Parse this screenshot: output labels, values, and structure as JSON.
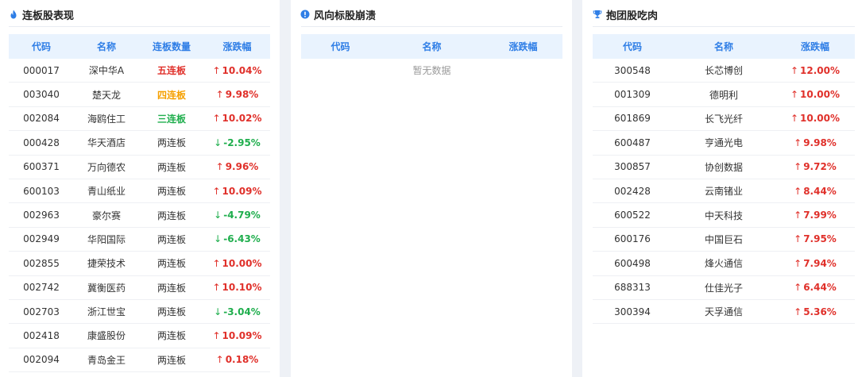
{
  "panels": {
    "streak": {
      "title": "连板股表现",
      "headers": [
        "代码",
        "名称",
        "连板数量",
        "涨跌幅"
      ],
      "rows": [
        {
          "code": "000017",
          "name": "深中华A",
          "board": "五连板",
          "board_level": "red",
          "dir": "up",
          "chg": "10.04%"
        },
        {
          "code": "003040",
          "name": "楚天龙",
          "board": "四连板",
          "board_level": "orange",
          "dir": "up",
          "chg": "9.98%"
        },
        {
          "code": "002084",
          "name": "海鸥住工",
          "board": "三连板",
          "board_level": "green",
          "dir": "up",
          "chg": "10.02%"
        },
        {
          "code": "000428",
          "name": "华天酒店",
          "board": "两连板",
          "board_level": "plain",
          "dir": "down",
          "chg": "-2.95%"
        },
        {
          "code": "600371",
          "name": "万向德农",
          "board": "两连板",
          "board_level": "plain",
          "dir": "up",
          "chg": "9.96%"
        },
        {
          "code": "600103",
          "name": "青山纸业",
          "board": "两连板",
          "board_level": "plain",
          "dir": "up",
          "chg": "10.09%"
        },
        {
          "code": "002963",
          "name": "豪尔赛",
          "board": "两连板",
          "board_level": "plain",
          "dir": "down",
          "chg": "-4.79%"
        },
        {
          "code": "002949",
          "name": "华阳国际",
          "board": "两连板",
          "board_level": "plain",
          "dir": "down",
          "chg": "-6.43%"
        },
        {
          "code": "002855",
          "name": "捷荣技术",
          "board": "两连板",
          "board_level": "plain",
          "dir": "up",
          "chg": "10.00%"
        },
        {
          "code": "002742",
          "name": "冀衡医药",
          "board": "两连板",
          "board_level": "plain",
          "dir": "up",
          "chg": "10.10%"
        },
        {
          "code": "002703",
          "name": "浙江世宝",
          "board": "两连板",
          "board_level": "plain",
          "dir": "down",
          "chg": "-3.04%"
        },
        {
          "code": "002418",
          "name": "康盛股份",
          "board": "两连板",
          "board_level": "plain",
          "dir": "up",
          "chg": "10.09%"
        },
        {
          "code": "002094",
          "name": "青岛金王",
          "board": "两连板",
          "board_level": "plain",
          "dir": "up",
          "chg": "0.18%"
        }
      ]
    },
    "collapse": {
      "title": "风向标股崩溃",
      "headers": [
        "代码",
        "名称",
        "涨跌幅"
      ],
      "empty_text": "暂无数据"
    },
    "cluster": {
      "title": "抱团股吃肉",
      "headers": [
        "代码",
        "名称",
        "涨跌幅"
      ],
      "rows": [
        {
          "code": "300548",
          "name": "长芯博创",
          "dir": "up",
          "chg": "12.00%"
        },
        {
          "code": "001309",
          "name": "德明利",
          "dir": "up",
          "chg": "10.00%"
        },
        {
          "code": "601869",
          "name": "长飞光纤",
          "dir": "up",
          "chg": "10.00%"
        },
        {
          "code": "600487",
          "name": "亨通光电",
          "dir": "up",
          "chg": "9.98%"
        },
        {
          "code": "300857",
          "name": "协创数据",
          "dir": "up",
          "chg": "9.72%"
        },
        {
          "code": "002428",
          "name": "云南锗业",
          "dir": "up",
          "chg": "8.44%"
        },
        {
          "code": "600522",
          "name": "中天科技",
          "dir": "up",
          "chg": "7.99%"
        },
        {
          "code": "600176",
          "name": "中国巨石",
          "dir": "up",
          "chg": "7.95%"
        },
        {
          "code": "600498",
          "name": "烽火通信",
          "dir": "up",
          "chg": "7.94%"
        },
        {
          "code": "688313",
          "name": "仕佳光子",
          "dir": "up",
          "chg": "6.44%"
        },
        {
          "code": "300394",
          "name": "天孚通信",
          "dir": "up",
          "chg": "5.36%"
        }
      ]
    }
  },
  "icons": {
    "streak": "flame-icon",
    "collapse": "alert-icon",
    "cluster": "trophy-icon"
  },
  "colors": {
    "accent": "#2f7ee6",
    "header_bg": "#e9f3fe",
    "up": "#e0302a",
    "down": "#1fae4d",
    "board_orange": "#f5a000",
    "arrow_up": "↑",
    "arrow_down": "↓"
  }
}
